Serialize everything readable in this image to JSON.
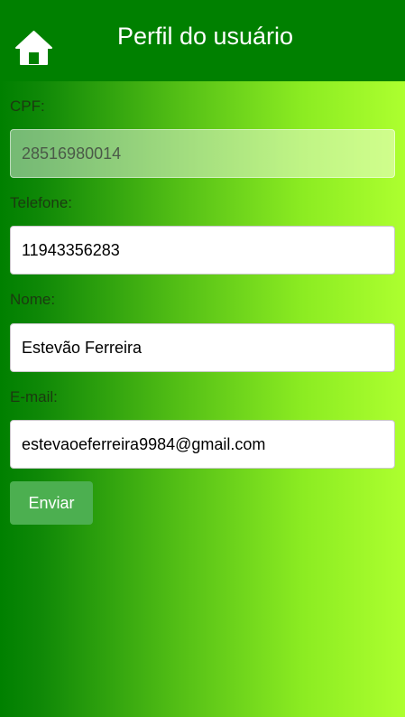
{
  "header": {
    "title": "Perfil do usuário",
    "home_icon": "home-icon"
  },
  "form": {
    "cpf": {
      "label": "CPF:",
      "value": "28516980014"
    },
    "telefone": {
      "label": "Telefone:",
      "value": "11943356283"
    },
    "nome": {
      "label": "Nome:",
      "value": "Estevão Ferreira"
    },
    "email": {
      "label": "E-mail:",
      "value": "estevaoeferreira9984@gmail.com"
    },
    "submit_label": "Enviar"
  },
  "colors": {
    "header_bg": "#008000",
    "gradient_start": "#008000",
    "gradient_end": "#adff2f",
    "button_bg": "#4caf50"
  }
}
